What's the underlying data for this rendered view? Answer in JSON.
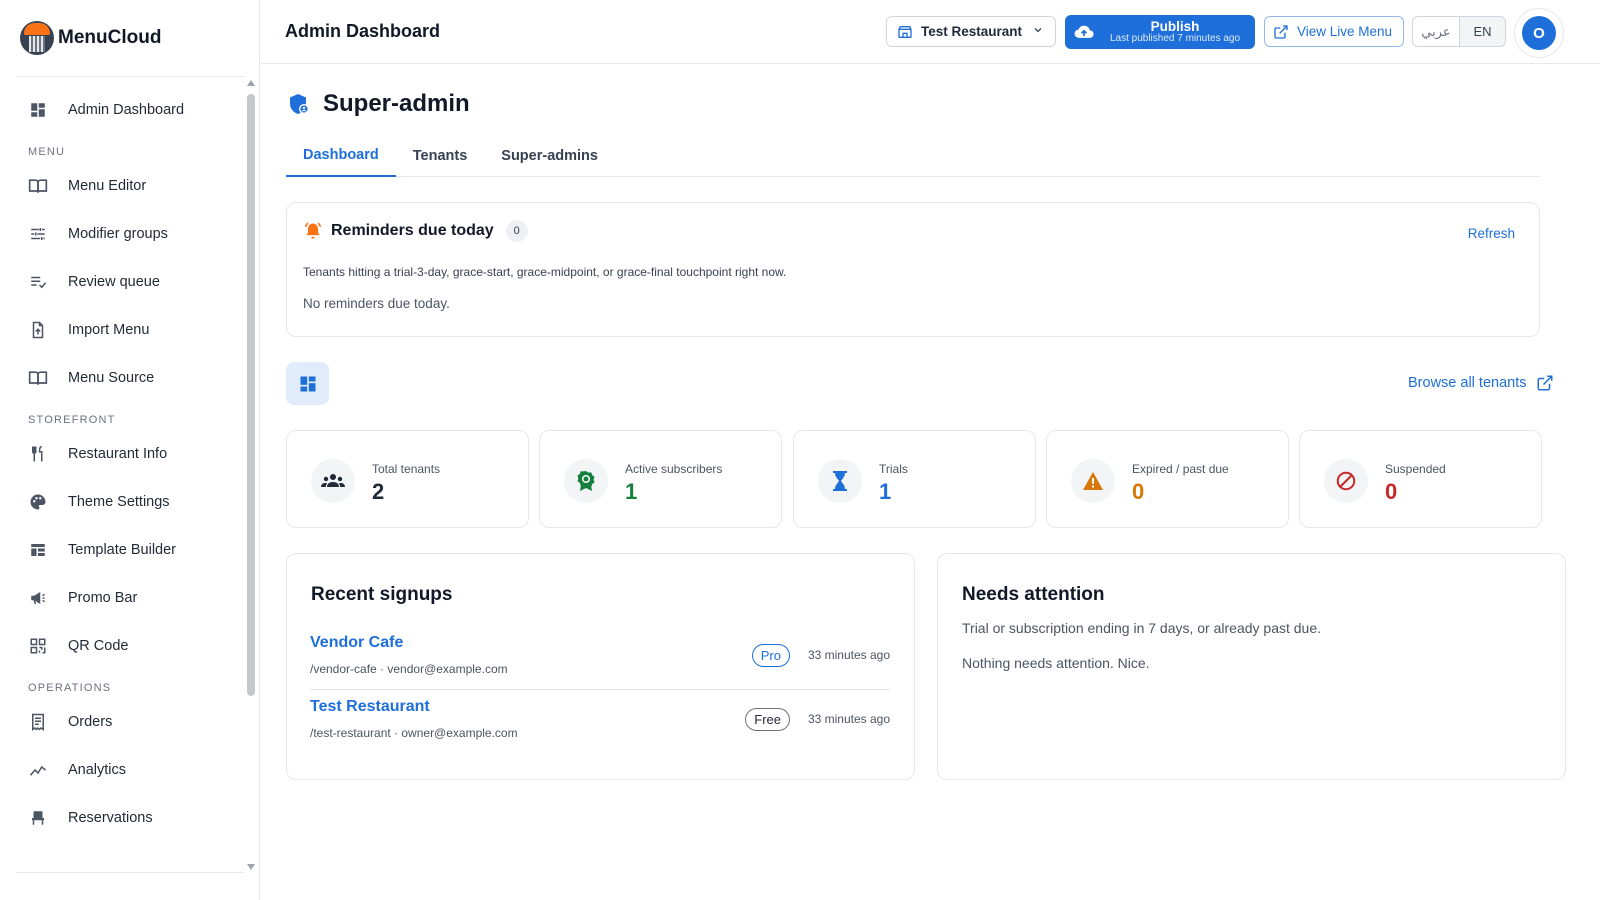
{
  "brand": {
    "name": "MenuCloud"
  },
  "sidebar": {
    "items": [
      {
        "type": "item",
        "label": "Admin Dashboard",
        "icon": "dashboard-icon"
      },
      {
        "type": "section",
        "label": "MENU"
      },
      {
        "type": "item",
        "label": "Menu Editor",
        "icon": "menu-book-icon"
      },
      {
        "type": "item",
        "label": "Modifier groups",
        "icon": "tune-icon"
      },
      {
        "type": "item",
        "label": "Review queue",
        "icon": "playlist-check-icon"
      },
      {
        "type": "item",
        "label": "Import Menu",
        "icon": "file-upload-icon"
      },
      {
        "type": "item",
        "label": "Menu Source",
        "icon": "menu-book-icon"
      },
      {
        "type": "section",
        "label": "STOREFRONT"
      },
      {
        "type": "item",
        "label": "Restaurant Info",
        "icon": "restaurant-icon"
      },
      {
        "type": "item",
        "label": "Theme Settings",
        "icon": "palette-icon"
      },
      {
        "type": "item",
        "label": "Template Builder",
        "icon": "template-icon"
      },
      {
        "type": "item",
        "label": "Promo Bar",
        "icon": "megaphone-icon"
      },
      {
        "type": "item",
        "label": "QR Code",
        "icon": "qr-code-icon"
      },
      {
        "type": "section",
        "label": "OPERATIONS"
      },
      {
        "type": "item",
        "label": "Orders",
        "icon": "receipt-icon"
      },
      {
        "type": "item",
        "label": "Analytics",
        "icon": "analytics-icon"
      },
      {
        "type": "item",
        "label": "Reservations",
        "icon": "table-chair-icon"
      }
    ]
  },
  "topbar": {
    "title": "Admin Dashboard",
    "tenant": "Test Restaurant",
    "publish_label": "Publish",
    "publish_sub": "Last published 7 minutes ago",
    "view_live": "View Live Menu",
    "lang_ar": "عربي",
    "lang_en": "EN",
    "avatar_initial": "O"
  },
  "page": {
    "title": "Super-admin",
    "tabs": [
      "Dashboard",
      "Tenants",
      "Super-admins"
    ],
    "active_tab": "Dashboard"
  },
  "reminders": {
    "title": "Reminders due today",
    "count": "0",
    "refresh": "Refresh",
    "description": "Tenants hitting a trial-3-day, grace-start, grace-midpoint, or grace-final touchpoint right now.",
    "empty": "No reminders due today."
  },
  "browse": {
    "label": "Browse all tenants"
  },
  "stats": [
    {
      "label": "Total tenants",
      "value": "2",
      "icon": "groups-icon",
      "color": "#1f2937"
    },
    {
      "label": "Active subscribers",
      "value": "1",
      "icon": "award-icon",
      "color": "#15803d"
    },
    {
      "label": "Trials",
      "value": "1",
      "icon": "hourglass-icon",
      "color": "#1e6fd9"
    },
    {
      "label": "Expired / past due",
      "value": "0",
      "icon": "warning-icon",
      "color": "#d97706"
    },
    {
      "label": "Suspended",
      "value": "0",
      "icon": "block-icon",
      "color": "#c62828"
    }
  ],
  "signups": {
    "title": "Recent signups",
    "rows": [
      {
        "name": "Vendor Cafe",
        "slug": "/vendor-cafe",
        "email": "vendor@example.com",
        "plan": "Pro",
        "time": "33 minutes ago"
      },
      {
        "name": "Test Restaurant",
        "slug": "/test-restaurant",
        "email": "owner@example.com",
        "plan": "Free",
        "time": "33 minutes ago"
      }
    ]
  },
  "needs": {
    "title": "Needs attention",
    "description": "Trial or subscription ending in 7 days, or already past due.",
    "empty": "Nothing needs attention. Nice."
  },
  "colors": {
    "accent": "#1e6fd9",
    "bell": "#f97316"
  }
}
